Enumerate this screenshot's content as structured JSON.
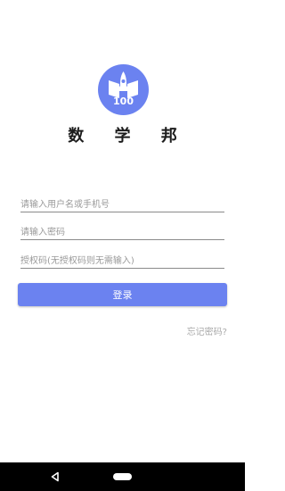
{
  "app": {
    "name": "数 学 邦",
    "logo_number": "100",
    "accent_color": "#6b82f0"
  },
  "form": {
    "username_placeholder": "请输入用户名或手机号",
    "password_placeholder": "请输入密码",
    "auth_placeholder": "授权码(无授权码则无需输入)",
    "login_label": "登录",
    "forgot_label": "忘记密码?"
  },
  "nav": {
    "back_icon": "triangle-back-icon",
    "home_icon": "pill-home-icon"
  }
}
